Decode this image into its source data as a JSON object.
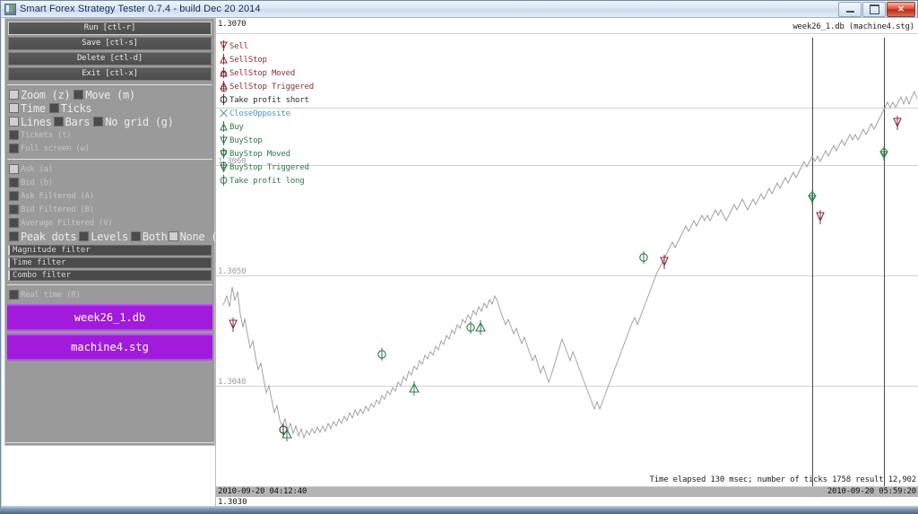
{
  "window": {
    "title": "Smart Forex Strategy Tester 0.7.4 - build Dec 20 2014",
    "icon": "app-icon",
    "minimize_label": "–",
    "maximize_label": "□",
    "close_label": "✕"
  },
  "sidebar": {
    "buttons": [
      {
        "label": "Run  [ctl-r]"
      },
      {
        "label": "Save  [ctl-s]"
      },
      {
        "label": "Delete  [ctl-d]"
      },
      {
        "label": "Exit  [ctl-x]"
      }
    ],
    "view_toggles_row1": [
      {
        "label": "Zoom  (z)",
        "checked": true
      },
      {
        "label": "Move  (m)",
        "checked": false
      }
    ],
    "view_toggles_row2": [
      {
        "label": "Time",
        "checked": true
      },
      {
        "label": "Ticks",
        "checked": false
      }
    ],
    "view_toggles_row3": [
      {
        "label": "Lines",
        "checked": true
      },
      {
        "label": "Bars",
        "checked": false
      },
      {
        "label": "No grid  (g)",
        "checked": false
      }
    ],
    "view_toggles_small": [
      {
        "label": "Tickets  (t)",
        "checked": false
      },
      {
        "label": "Full screen  (w)",
        "checked": false
      }
    ],
    "feed_toggles": [
      {
        "label": "Ask  (a)",
        "checked": true
      },
      {
        "label": "Bid  (b)",
        "checked": false
      },
      {
        "label": "Ask Filtered  (A)",
        "checked": false
      },
      {
        "label": "Bid Filtered  (B)",
        "checked": false
      },
      {
        "label": "Average Filtered  (V)",
        "checked": false
      }
    ],
    "peak_toggles": [
      {
        "label": "Peak dots",
        "checked": false
      },
      {
        "label": "Levels",
        "checked": false
      },
      {
        "label": "Both",
        "checked": false
      },
      {
        "label": "None  (P)",
        "checked": true
      }
    ],
    "filters": [
      {
        "label": "Magnitude filter",
        "value": ""
      },
      {
        "label": "Time filter",
        "value": ""
      },
      {
        "label": "Combo filter",
        "value": ""
      }
    ],
    "realtime_toggle": {
      "label": "Real time  (R)",
      "checked": false
    },
    "file_buttons": [
      {
        "label": "week26_1.db"
      },
      {
        "label": "machine4.stg"
      }
    ],
    "accent_color": "#a21bdd"
  },
  "chart": {
    "db_label": "week26_1.db (machine4.stg)",
    "y_top_label": "1.3070",
    "y_labels": [
      "1.3070",
      "1.3060",
      "1.3050",
      "1.3040",
      "1.3030"
    ],
    "y_values": [
      1.307,
      1.306,
      1.305,
      1.304,
      1.303
    ],
    "bottom_price": "1.3030",
    "status": "Time elapsed 130 msec; number of ticks 1758 result 12,902",
    "time_start": "2010-09-20 04:12:40",
    "time_end": "2010-09-20 05:59:20",
    "legend": [
      {
        "label": "Sell",
        "icon": "sell-marker",
        "color": "#8b2f33"
      },
      {
        "label": "SellStop",
        "icon": "sellstop-marker",
        "color": "#8b2f33"
      },
      {
        "label": "SellStop Moved",
        "icon": "sellstop-moved-marker",
        "color": "#8b2f33"
      },
      {
        "label": "SellStop Triggered",
        "icon": "sellstop-triggered-marker",
        "color": "#8b2f33"
      },
      {
        "label": "Take profit short",
        "icon": "take-profit-short-marker",
        "color": "#2f2f2f"
      },
      {
        "label": "CloseOpposite",
        "icon": "close-opposite-marker",
        "color": "#4f8fc0"
      },
      {
        "label": "Buy",
        "icon": "buy-marker",
        "color": "#2f7a45"
      },
      {
        "label": "BuyStop",
        "icon": "buystop-marker",
        "color": "#2f7a45"
      },
      {
        "label": "BuyStop Moved",
        "icon": "buystop-moved-marker",
        "color": "#2f7a45"
      },
      {
        "label": "BuyStop Triggered",
        "icon": "buystop-triggered-marker",
        "color": "#2f7a45"
      },
      {
        "label": "Take profit long",
        "icon": "take-profit-long-marker",
        "color": "#2f7a45"
      }
    ]
  },
  "chart_data": {
    "type": "line",
    "title": "week26_1.db (machine4.stg)",
    "xlabel": "",
    "ylabel": "",
    "ylim": [
      1.3028,
      1.3072
    ],
    "xlim": [
      "2010-09-20 04:12:40",
      "2010-09-20 05:59:20"
    ],
    "grid": true,
    "gridlines_y": [
      1.307,
      1.306,
      1.305,
      1.304,
      1.303
    ],
    "series": [
      {
        "name": "Ask",
        "color": "#9a9a9a",
        "points": [
          1.30492,
          1.30497,
          1.30503,
          1.30488,
          1.30478,
          1.30493,
          1.30486,
          1.3047,
          1.30462,
          1.30455,
          1.30448,
          1.30441,
          1.30436,
          1.3043,
          1.30425,
          1.30418,
          1.30412,
          1.30408,
          1.30401,
          1.30396,
          1.3039,
          1.30385,
          1.3038,
          1.30374,
          1.30368,
          1.30363,
          1.30358,
          1.30354,
          1.3035,
          1.30346,
          1.30343,
          1.3034,
          1.30344,
          1.30341,
          1.30338,
          1.30342,
          1.30347,
          1.30344,
          1.3035,
          1.30355,
          1.30352,
          1.30358,
          1.30363,
          1.3036,
          1.30366,
          1.30372,
          1.30369,
          1.30375,
          1.30381,
          1.30386,
          1.30392,
          1.30388,
          1.30395,
          1.30402,
          1.30408,
          1.30414,
          1.3041,
          1.30418,
          1.30425,
          1.30432,
          1.3044,
          1.30448,
          1.30455,
          1.30463,
          1.3047,
          1.30478,
          1.30485,
          1.30492,
          1.30498,
          1.30503,
          1.30499,
          1.30492,
          1.30485,
          1.30478,
          1.3047,
          1.30462,
          1.30455,
          1.30448,
          1.30442,
          1.30436,
          1.3043,
          1.30425,
          1.30419,
          1.30423,
          1.30431,
          1.3044,
          1.30448,
          1.30455,
          1.3045,
          1.30444,
          1.30451,
          1.3046,
          1.3047,
          1.3048,
          1.3049,
          1.30498,
          1.30505,
          1.30512,
          1.30518,
          1.3051,
          1.30503,
          1.30496,
          1.3049,
          1.30485,
          1.30492,
          1.305,
          1.30508,
          1.30515,
          1.30521,
          1.30527,
          1.30532,
          1.30527,
          1.30521,
          1.30515,
          1.30508,
          1.30501,
          1.30495,
          1.30488,
          1.30481,
          1.30474,
          1.30468,
          1.30462,
          1.3047,
          1.30478,
          1.30486,
          1.30494,
          1.30502,
          1.3051,
          1.30518,
          1.30526,
          1.30533,
          1.3054,
          1.30547,
          1.30554,
          1.3056,
          1.30553,
          1.30546,
          1.30539,
          1.30532,
          1.3054,
          1.30548,
          1.30556,
          1.30563,
          1.3057,
          1.30577,
          1.30584,
          1.30591,
          1.30598,
          1.30604,
          1.3061,
          1.30617,
          1.30624,
          1.3063,
          1.30636,
          1.30642,
          1.30648,
          1.30654,
          1.3066,
          1.30666,
          1.30672,
          1.30663,
          1.30655,
          1.30662,
          1.3067,
          1.30678,
          1.30686,
          1.30694,
          1.307,
          1.30693,
          1.30686,
          1.30694,
          1.30702,
          1.30696,
          1.30688,
          1.30682,
          1.3069,
          1.30698,
          1.30705,
          1.307,
          1.30694,
          1.30688,
          1.30696,
          1.30703,
          1.30697,
          1.30691,
          1.30698,
          1.30705,
          1.30699,
          1.30693,
          1.30687
        ]
      }
    ],
    "markers": [
      {
        "type": "Sell",
        "x_pct": 2.6,
        "price": 1.30456,
        "color": "#8b2f33"
      },
      {
        "type": "Take profit long",
        "x_pct": 10.4,
        "price": 1.30347,
        "color": "#2f2f2f"
      },
      {
        "type": "Buy",
        "x_pct": 11.2,
        "price": 1.30343,
        "color": "#2f7a45"
      },
      {
        "type": "Take profit long",
        "x_pct": 26.0,
        "price": 1.30434,
        "color": "#2f7a45"
      },
      {
        "type": "Buy",
        "x_pct": 39.8,
        "price": 1.30401,
        "color": "#2f7a45"
      },
      {
        "type": "Take profit long",
        "x_pct": 45.3,
        "price": 1.30462,
        "color": "#2f7a45"
      },
      {
        "type": "Buy",
        "x_pct": 47.2,
        "price": 1.30462,
        "color": "#2f7a45"
      },
      {
        "type": "Take profit long",
        "x_pct": 63.1,
        "price": 1.30522,
        "color": "#2f7a45"
      },
      {
        "type": "Sell",
        "x_pct": 66.1,
        "price": 1.30516,
        "color": "#8b2f33"
      },
      {
        "type": "BuyStop Triggered",
        "x_pct": 87.2,
        "price": 1.30588,
        "color": "#2f7a45"
      },
      {
        "type": "Sell",
        "x_pct": 88.4,
        "price": 1.30569,
        "color": "#8b2f33"
      },
      {
        "type": "BuyStop Triggered",
        "x_pct": 97.5,
        "price": 1.30636,
        "color": "#2f7a45"
      },
      {
        "type": "Sell",
        "x_pct": 99.3,
        "price": 1.30622,
        "color": "#8b2f33"
      }
    ],
    "vertical_cursors": [
      87.2,
      97.5
    ]
  }
}
